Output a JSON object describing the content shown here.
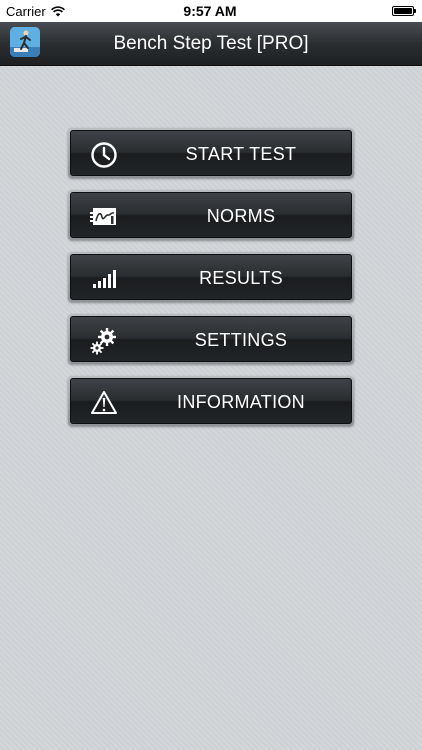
{
  "status_bar": {
    "carrier": "Carrier",
    "time": "9:57 AM"
  },
  "nav": {
    "title": "Bench Step Test [PRO]"
  },
  "menu": {
    "items": [
      {
        "label": "START TEST",
        "icon": "clock-icon"
      },
      {
        "label": "NORMS",
        "icon": "chart-card-icon"
      },
      {
        "label": "RESULTS",
        "icon": "signal-bars-icon"
      },
      {
        "label": "SETTINGS",
        "icon": "gears-icon"
      },
      {
        "label": "INFORMATION",
        "icon": "warning-triangle-icon"
      }
    ]
  },
  "colors": {
    "nav_bar": "#2b2e31",
    "button_face": "#2a2d30",
    "background": "#d1d5d8",
    "text_light": "#ffffff"
  }
}
